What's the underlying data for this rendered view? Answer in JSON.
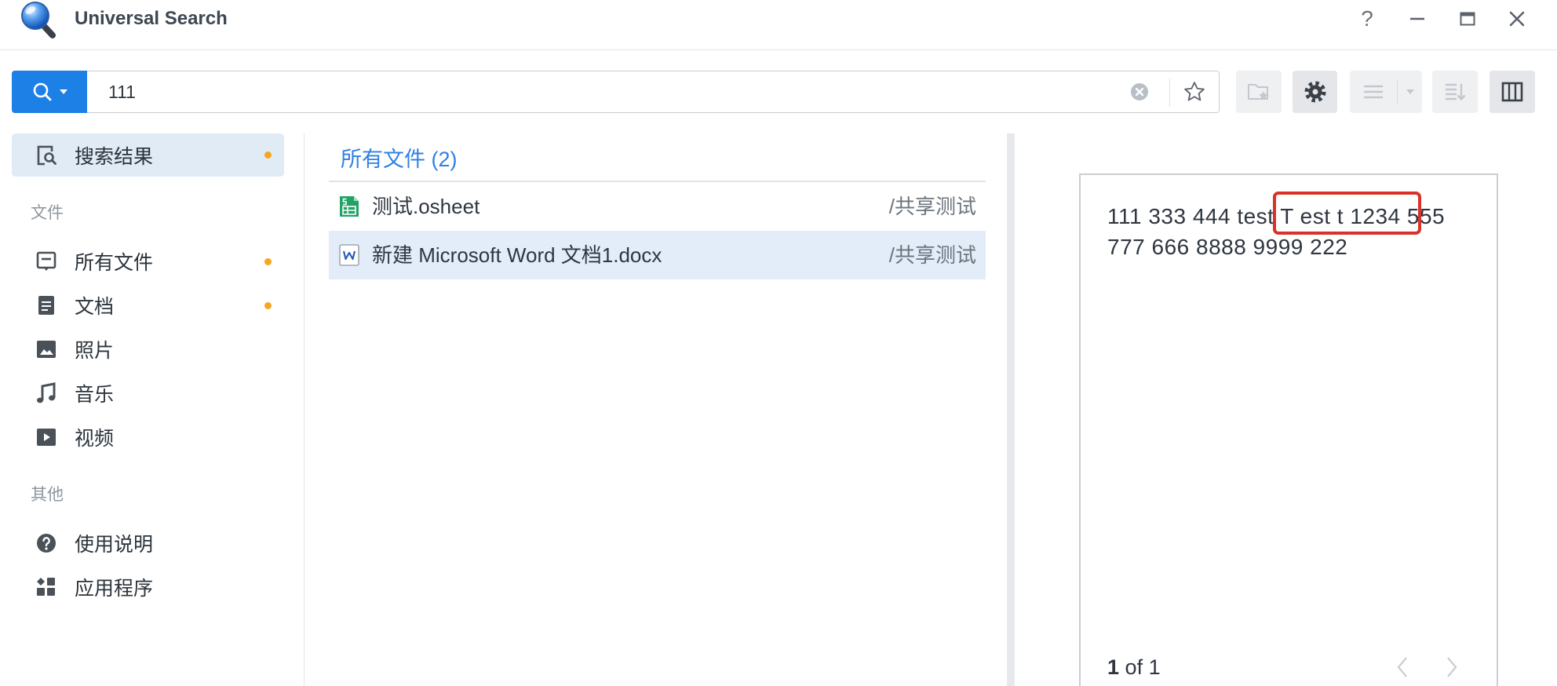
{
  "theme": {
    "accent": "#1d80e6",
    "badge": "#f5a623",
    "highlight_box": "#d9322b",
    "selected_bg": "#e2edf9"
  },
  "window": {
    "title": "Universal Search",
    "app_icon": "universal-search-magnifier-icon",
    "controls": {
      "help": "?",
      "minimize_icon": "minimize-icon",
      "maximize_icon": "maximize-icon",
      "close_icon": "close-icon"
    }
  },
  "search": {
    "query": "111",
    "search_button_icon": "search-icon",
    "clear_icon": "clear-icon",
    "favorite_icon": "star-icon"
  },
  "toolbar": {
    "buttons": [
      {
        "icon": "folder-star-icon",
        "enabled": false
      },
      {
        "icon": "gear-icon",
        "enabled": true
      },
      {
        "icon": "list-view-icon",
        "enabled": false,
        "has_dropdown": true
      },
      {
        "icon": "sort-icon",
        "enabled": false
      },
      {
        "icon": "columns-layout-icon",
        "enabled": true
      }
    ]
  },
  "sidebar": {
    "active_item": {
      "label": "搜索结果",
      "icon": "search-results-icon",
      "badge": true
    },
    "sections": [
      {
        "label": "文件",
        "items": [
          {
            "label": "所有文件",
            "icon": "all-files-icon",
            "badge": true
          },
          {
            "label": "文档",
            "icon": "document-icon",
            "badge": true
          },
          {
            "label": "照片",
            "icon": "photo-icon",
            "badge": false
          },
          {
            "label": "音乐",
            "icon": "music-icon",
            "badge": false
          },
          {
            "label": "视频",
            "icon": "video-icon",
            "badge": false
          }
        ]
      },
      {
        "label": "其他",
        "items": [
          {
            "label": "使用说明",
            "icon": "help-icon",
            "badge": false
          },
          {
            "label": "应用程序",
            "icon": "apps-icon",
            "badge": false
          }
        ]
      }
    ]
  },
  "results": {
    "header": "所有文件 (2)",
    "rows": [
      {
        "name": "测试.osheet",
        "path": "/共享测试",
        "file_icon": "osheet-file-icon",
        "selected": false
      },
      {
        "name": "新建 Microsoft Word 文档1.docx",
        "path": "/共享测试",
        "file_icon": "docx-file-icon",
        "selected": true
      }
    ]
  },
  "preview": {
    "lines": [
      {
        "before": "111 333 444 test ",
        "highlight": "T est t 1234",
        "after": " 555"
      },
      {
        "text": "777 666 8888 9999 222"
      }
    ],
    "page": {
      "current": "1",
      "of": "of",
      "total": "1"
    },
    "prev_icon": "chevron-left-icon",
    "next_icon": "chevron-right-icon"
  }
}
